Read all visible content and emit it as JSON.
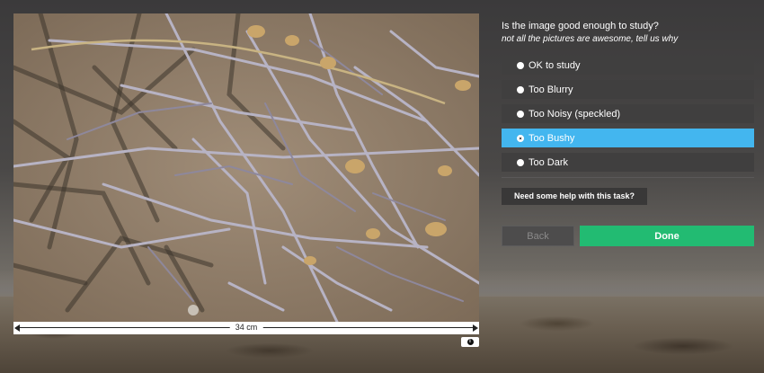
{
  "subject": {
    "scale_label": "34 cm",
    "info_icon": "info-icon"
  },
  "task": {
    "question": "Is the image good enough to study?",
    "help": "not all the pictures are awesome, tell us why",
    "answers": [
      {
        "label": "OK to study",
        "selected": false
      },
      {
        "label": "Too Blurry",
        "selected": false
      },
      {
        "label": "Too Noisy (speckled)",
        "selected": false
      },
      {
        "label": "Too Bushy",
        "selected": true
      },
      {
        "label": "Too Dark",
        "selected": false
      }
    ],
    "help_button": "Need some help with this task?"
  },
  "controls": {
    "back_label": "Back",
    "done_label": "Done"
  },
  "colors": {
    "selected_answer": "#43b6ef",
    "answer_bg": "#403f3f",
    "done_button": "#22bb72"
  }
}
